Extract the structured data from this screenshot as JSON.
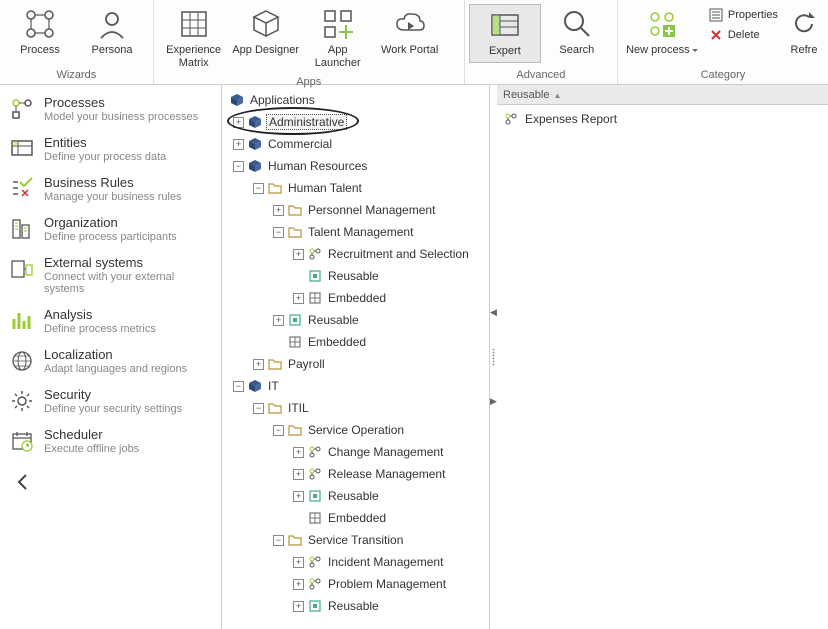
{
  "ribbon": {
    "groups": {
      "wizards": {
        "label": "Wizards",
        "process": "Process",
        "persona": "Persona"
      },
      "apps": {
        "label": "Apps",
        "experience": "Experience Matrix",
        "designer": "App Designer",
        "launcher": "App Launcher",
        "portal": "Work Portal"
      },
      "advanced": {
        "label": "Advanced",
        "expert": "Expert",
        "search": "Search"
      },
      "category": {
        "label": "Category",
        "newprocess": "New process",
        "properties": "Properties",
        "delete": "Delete",
        "refresh": "Refre"
      }
    }
  },
  "sidebar": {
    "items": [
      {
        "title": "Processes",
        "subtitle": "Model your business processes"
      },
      {
        "title": "Entities",
        "subtitle": "Define your process data"
      },
      {
        "title": "Business Rules",
        "subtitle": "Manage your business rules"
      },
      {
        "title": "Organization",
        "subtitle": "Define process participants"
      },
      {
        "title": "External systems",
        "subtitle": "Connect with your external systems"
      },
      {
        "title": "Analysis",
        "subtitle": "Define process metrics"
      },
      {
        "title": "Localization",
        "subtitle": "Adapt languages and regions"
      },
      {
        "title": "Security",
        "subtitle": "Define your security settings"
      },
      {
        "title": "Scheduler",
        "subtitle": "Execute offline jobs"
      }
    ]
  },
  "tree": {
    "root": "Applications",
    "admin": "Administrative",
    "commercial": "Commercial",
    "hr": "Human Resources",
    "humantalent": "Human Talent",
    "personnel": "Personnel Management",
    "talent": "Talent Management",
    "recruitment": "Recruitment and Selection",
    "reusable": "Reusable",
    "embedded": "Embedded",
    "payroll": "Payroll",
    "it": "IT",
    "itil": "ITIL",
    "servop": "Service Operation",
    "change": "Change Management",
    "release": "Release Management",
    "servtrans": "Service Transition",
    "incident": "Incident Management",
    "problem": "Problem Management"
  },
  "rightpane": {
    "header": "Reusable",
    "item1": "Expenses Report"
  }
}
